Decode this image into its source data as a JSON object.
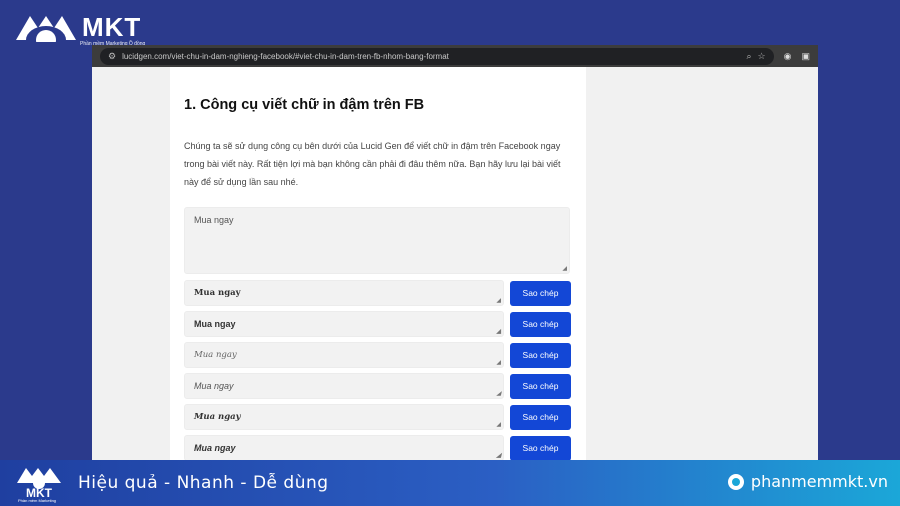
{
  "brand": {
    "name": "MKT",
    "tagline": "Phần mềm Marketing Ồ đồng"
  },
  "browser": {
    "url": "lucidgen.com/viet-chu-in-dam-nghieng-facebook/#viet-chu-in-dam-tren-fb-nhom-bang-format",
    "icons": [
      "site-settings-icon",
      "zoom-icon",
      "bookmark-star-icon",
      "extension-icon",
      "camera-icon"
    ]
  },
  "article": {
    "heading": "1. Công cụ viết chữ in đậm trên FB",
    "intro": "Chúng ta sẽ sử dụng công cụ bên dưới của Lucid Gen để viết chữ in đậm trên Facebook ngay trong bài viết này. Rất tiện lợi mà bạn không cần phải đi đâu thêm nữa. Bạn hãy lưu lại bài viết này để sử dụng lần sau nhé.",
    "input_value": "Mua ngay",
    "copy_label": "Sao chép",
    "outputs": [
      {
        "text": "Mua ngay",
        "style": "bold-serif"
      },
      {
        "text": "Mua ngay",
        "style": "bold-sans"
      },
      {
        "text": "Mua ngay",
        "style": "italic-serif"
      },
      {
        "text": "Mua ngay",
        "style": "italic-sans"
      },
      {
        "text": "Mua ngay",
        "style": "bolditalic-serif"
      },
      {
        "text": "Mua ngay",
        "style": "bolditalic-sans"
      }
    ]
  },
  "banner": {
    "slogan": "Hiệu quả - Nhanh  - Dễ dùng",
    "website": "phanmemmkt.vn",
    "logo_text": "MKT",
    "logo_sub": "Phần mềm Marketing"
  },
  "colors": {
    "background": "#2b3a8c",
    "copy_button": "#1347d6",
    "banner_start": "#1f3fa0",
    "banner_end": "#1ba7d8"
  }
}
